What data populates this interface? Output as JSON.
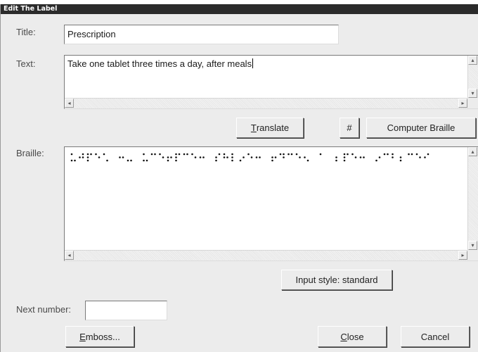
{
  "window": {
    "title": "Edit The Label"
  },
  "title_field": {
    "label": "Title:",
    "value": "Prescription"
  },
  "text_field": {
    "label": "Text:",
    "value": "Take one tablet three times a day, after meals"
  },
  "braille_field": {
    "label": "Braille:",
    "cells": [
      [
        1,
        3,
        6
      ],
      [
        2,
        4,
        5
      ],
      [
        1,
        2,
        3,
        4
      ],
      [
        1,
        5
      ],
      [
        1,
        6
      ],
      [
        2,
        5
      ],
      [
        3,
        6
      ],
      [
        1,
        3,
        6
      ],
      [
        1,
        4
      ],
      [
        1,
        5
      ],
      [
        2,
        3,
        5
      ],
      [
        1,
        2,
        3,
        4
      ],
      [
        1,
        4
      ],
      [
        1,
        5
      ],
      [
        2,
        5
      ],
      [
        2,
        3,
        4
      ],
      [
        1,
        2,
        5
      ],
      [
        1,
        2,
        3
      ],
      [
        3,
        5
      ],
      [
        1,
        5
      ],
      [
        2,
        5
      ],
      [
        2,
        3,
        5
      ],
      [
        1,
        4,
        5
      ],
      [
        1,
        4
      ],
      [
        1,
        5
      ],
      [
        2,
        6
      ],
      [
        1
      ],
      [
        2,
        3
      ],
      [
        1,
        2,
        3,
        4
      ],
      [
        1,
        5
      ],
      [
        2,
        5
      ],
      [
        3,
        5
      ],
      [
        1,
        4
      ],
      [
        1,
        2
      ],
      [
        2,
        3
      ],
      [
        1,
        4
      ],
      [
        1,
        5
      ],
      [
        2,
        4
      ]
    ],
    "gaps_after": [
      4,
      6,
      14,
      20,
      25,
      26,
      30
    ]
  },
  "buttons": {
    "translate": {
      "underline": "T",
      "rest": "ranslate"
    },
    "hash": "#",
    "computer_braille": "Computer Braille",
    "input_style": "Input style: standard",
    "emboss": {
      "underline": "E",
      "rest": "mboss..."
    },
    "close": {
      "underline": "C",
      "rest": "lose"
    },
    "cancel": "Cancel"
  },
  "next_number": {
    "label": "Next number:",
    "value": ""
  },
  "scroll_icons": {
    "up": "scroll-up-arrow",
    "down": "scroll-down-arrow",
    "left": "scroll-left-arrow",
    "right": "scroll-right-arrow"
  }
}
